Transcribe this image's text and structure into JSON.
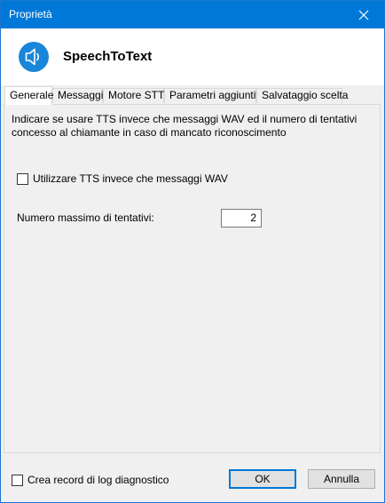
{
  "window": {
    "title": "Proprietà"
  },
  "header": {
    "app_name": "SpeechToText",
    "icon": "speaker-icon"
  },
  "tabs": [
    {
      "label": "Generale",
      "active": true
    },
    {
      "label": "Messaggi",
      "active": false
    },
    {
      "label": "Motore STT",
      "active": false
    },
    {
      "label": "Parametri aggiuntivi",
      "active": false
    },
    {
      "label": "Salvataggio scelta",
      "active": false
    }
  ],
  "general": {
    "description": "Indicare se usare TTS invece che messaggi WAV ed il numero di tentativi concesso al chiamante in caso di mancato riconoscimento",
    "use_tts_label": "Utilizzare TTS invece che messaggi WAV",
    "use_tts_checked": false,
    "max_attempts_label": "Numero massimo di tentativi:",
    "max_attempts_value": "2"
  },
  "footer": {
    "log_label": "Crea record di log diagnostico",
    "log_checked": false,
    "ok_label": "OK",
    "cancel_label": "Annulla"
  },
  "colors": {
    "titlebar": "#0078d7",
    "accent": "#0078d7"
  }
}
